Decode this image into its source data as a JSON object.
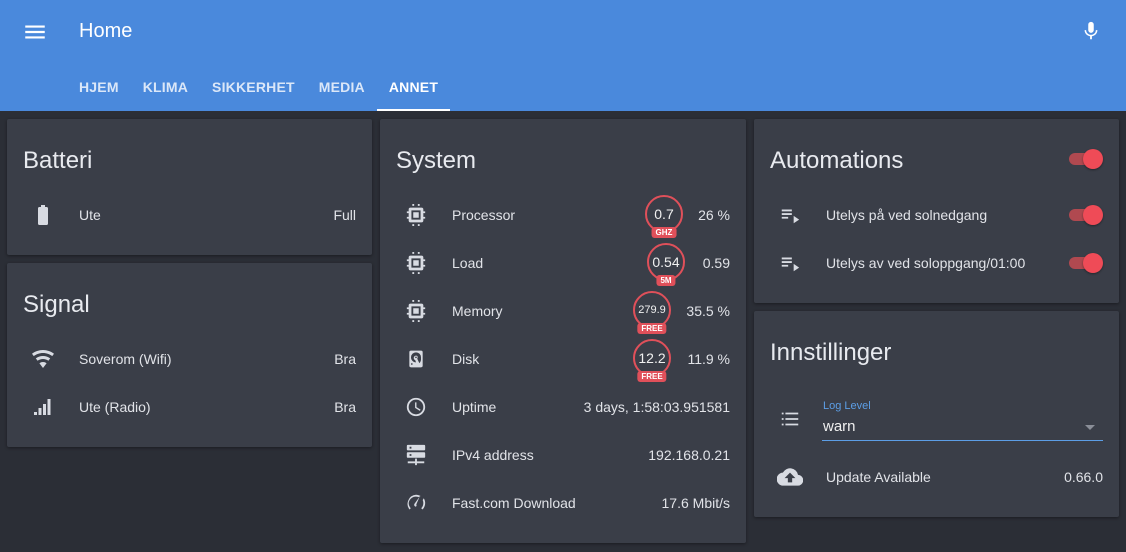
{
  "header": {
    "title": "Home",
    "menu_icon": "menu-icon",
    "mic_icon": "microphone-icon",
    "tabs": [
      {
        "label": "HJEM",
        "active": false
      },
      {
        "label": "KLIMA",
        "active": false
      },
      {
        "label": "SIKKERHET",
        "active": false
      },
      {
        "label": "MEDIA",
        "active": false
      },
      {
        "label": "ANNET",
        "active": true
      }
    ]
  },
  "batteri": {
    "title": "Batteri",
    "rows": [
      {
        "icon": "battery-icon",
        "name": "Ute",
        "value": "Full"
      }
    ]
  },
  "signal": {
    "title": "Signal",
    "rows": [
      {
        "icon": "wifi-icon",
        "name": "Soverom (Wifi)",
        "value": "Bra"
      },
      {
        "icon": "signal-bars-icon",
        "name": "Ute (Radio)",
        "value": "Bra"
      }
    ]
  },
  "system": {
    "title": "System",
    "rows": [
      {
        "icon": "chip-icon",
        "name": "Processor",
        "badge": "0.7",
        "badge_label": "GHZ",
        "value": "26 %"
      },
      {
        "icon": "chip-icon",
        "name": "Load",
        "badge": "0.54",
        "badge_label": "5M",
        "value": "0.59"
      },
      {
        "icon": "chip-icon",
        "name": "Memory",
        "badge": "279.9",
        "badge_label": "FREE",
        "value": "35.5 %"
      },
      {
        "icon": "harddisk-icon",
        "name": "Disk",
        "badge": "12.2",
        "badge_label": "FREE",
        "value": "11.9 %"
      },
      {
        "icon": "clock-icon",
        "name": "Uptime",
        "value": "3 days, 1:58:03.951581"
      },
      {
        "icon": "server-network-icon",
        "name": "IPv4 address",
        "value": "192.168.0.21"
      },
      {
        "icon": "speedometer-icon",
        "name": "Fast.com Download",
        "value": "17.6 Mbit/s"
      }
    ]
  },
  "automations": {
    "title": "Automations",
    "master_on": true,
    "rows": [
      {
        "icon": "playlist-play-icon",
        "name": "Utelys på ved solnedgang",
        "on": true
      },
      {
        "icon": "playlist-play-icon",
        "name": "Utelys av ved soloppgang/01:00",
        "on": true
      }
    ]
  },
  "innstillinger": {
    "title": "Innstillinger",
    "log_level": {
      "icon": "format-list-icon",
      "label": "Log Level",
      "value": "warn"
    },
    "update": {
      "icon": "cloud-upload-icon",
      "name": "Update Available",
      "value": "0.66.0"
    }
  },
  "colors": {
    "header": "#4a89dc",
    "background": "#2b2e36",
    "card": "#3a3e48",
    "accent": "#ef4b57",
    "link": "#5c9ee6"
  }
}
